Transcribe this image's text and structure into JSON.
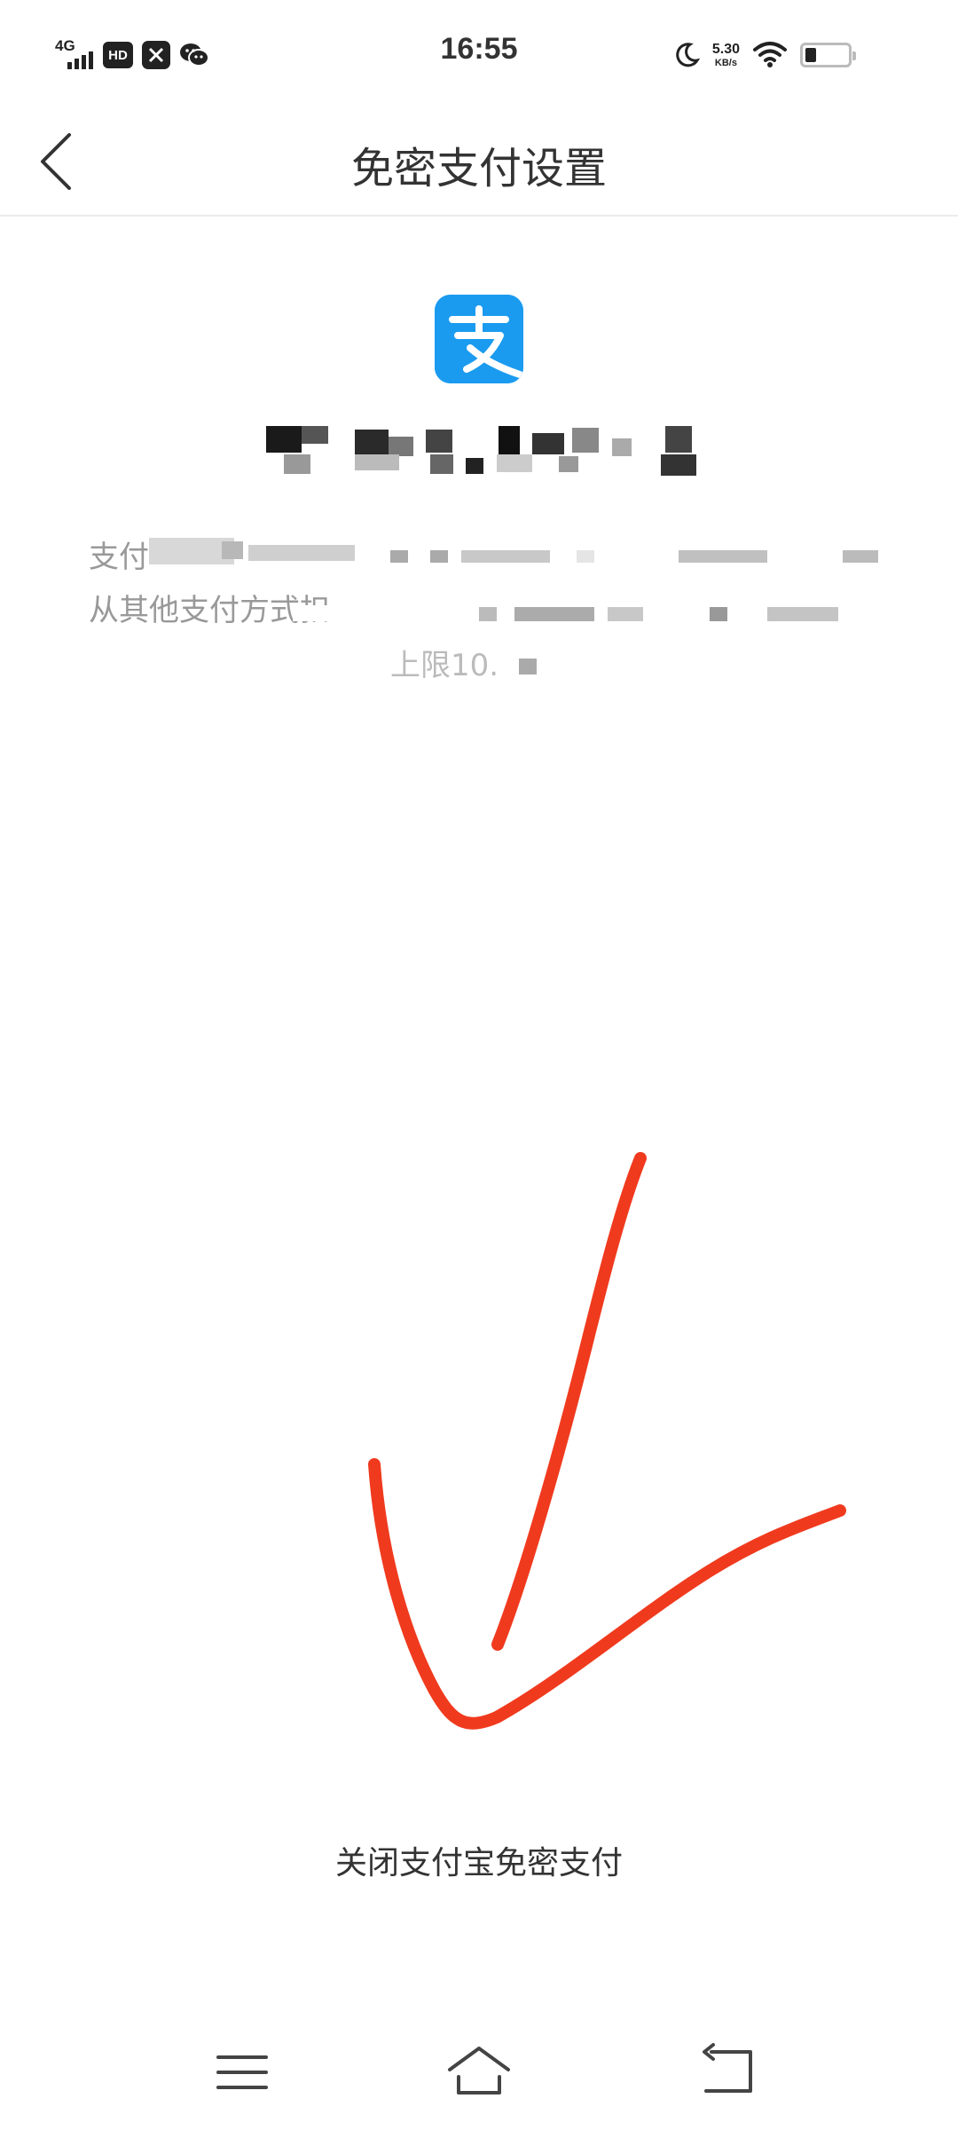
{
  "status_bar": {
    "network": "4G",
    "hd_badge": "HD",
    "time": "16:55",
    "speed_value": "5.30",
    "speed_unit": "KB/s",
    "battery_level": 0.25
  },
  "nav": {
    "title": "免密支付设置"
  },
  "app": {
    "logo_char": "支",
    "logo_color": "#1a9bf0"
  },
  "description": {
    "line1_prefix": "支付",
    "line2_prefix": "从其他支付方式扣",
    "line3_prefix": "上限10."
  },
  "actions": {
    "close_label": "关闭支付宝免密支付"
  },
  "annotation": {
    "color": "#f03a1e"
  },
  "icons": {
    "back": "chevron-left-icon",
    "menu": "menu-icon",
    "home": "home-icon",
    "return": "return-icon"
  }
}
